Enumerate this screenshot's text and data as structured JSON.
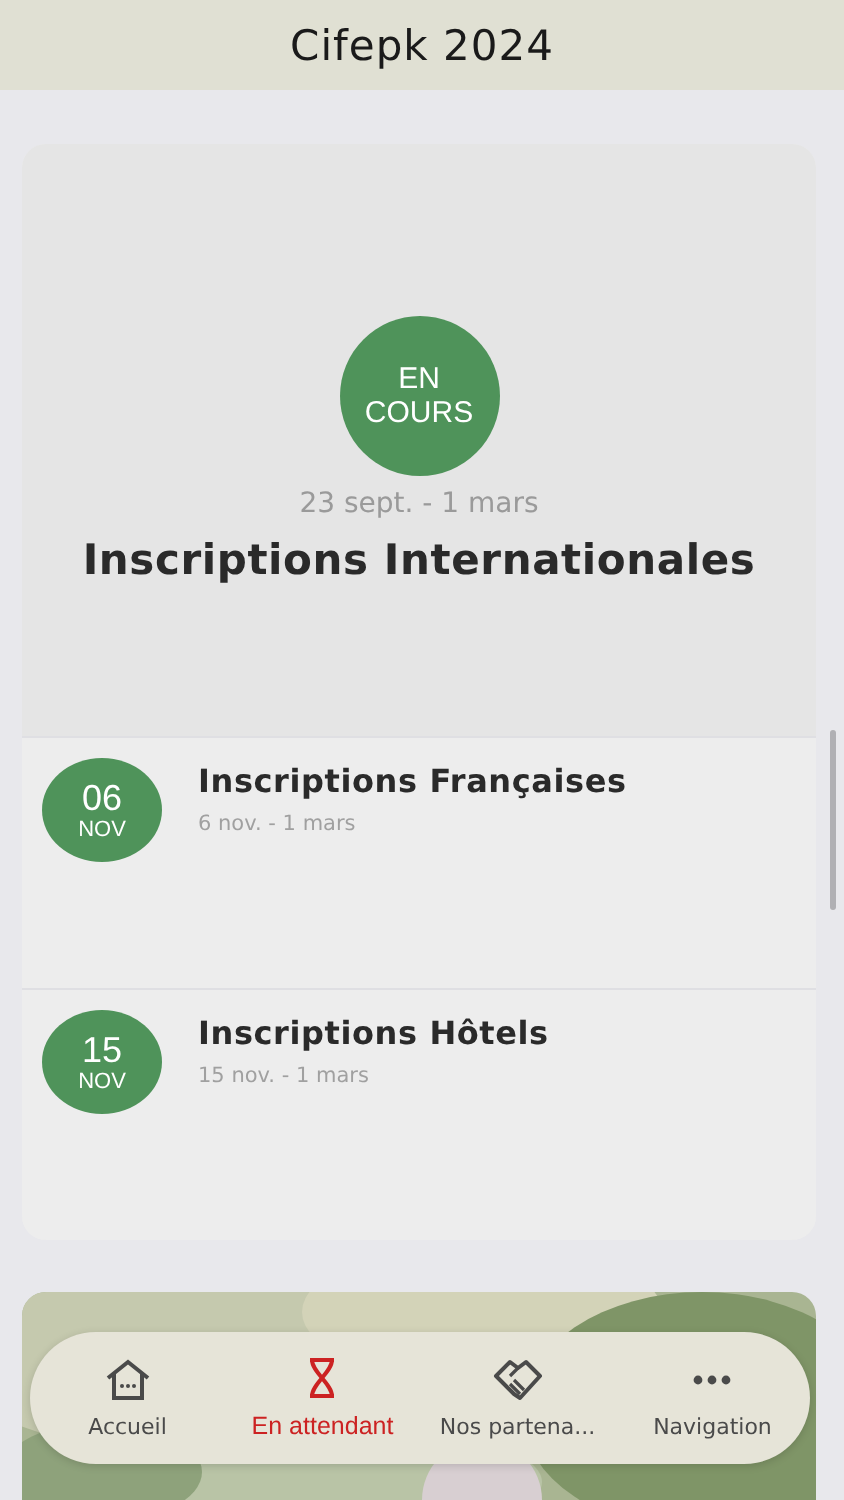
{
  "header": {
    "title": "Cifepk 2024"
  },
  "featured": {
    "badge": [
      "EN",
      "COURS"
    ],
    "dates": "23 sept. - 1 mars",
    "title": "Inscriptions Internationales"
  },
  "events": [
    {
      "day": "06",
      "month": "NOV",
      "title": "Inscriptions Françaises",
      "dates": "6 nov. - 1 mars"
    },
    {
      "day": "15",
      "month": "NOV",
      "title": "Inscriptions Hôtels",
      "dates": "15 nov. - 1 mars"
    }
  ],
  "tab_bar": [
    {
      "label": "Accueil",
      "selected": false
    },
    {
      "label": "En attendant",
      "selected": true
    },
    {
      "label": "Nos partena...",
      "selected": false
    },
    {
      "label": "Navigation",
      "selected": false
    }
  ]
}
